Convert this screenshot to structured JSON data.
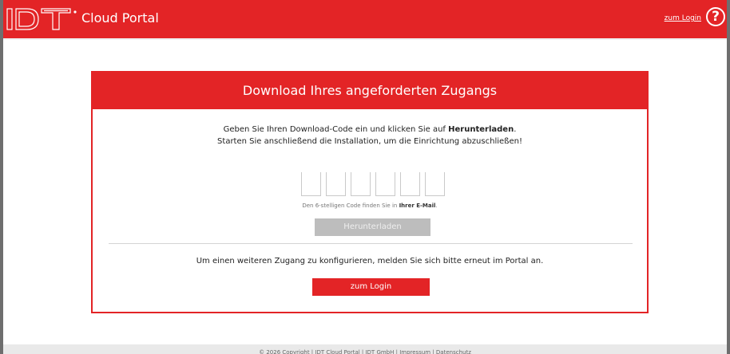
{
  "header": {
    "logo_text": "IDT",
    "brand": "Cloud Portal",
    "login_link": "zum Login",
    "help_symbol": "?",
    "color": "#e32426"
  },
  "panel": {
    "title": "Download Ihres angeforderten Zugangs",
    "intro_line1_pre": "Geben Sie Ihren Download-Code ein und klicken Sie auf ",
    "intro_line1_bold": "Herunterladen",
    "intro_line1_post": ".",
    "intro_line2": "Starten Sie anschließend die Installation, um die Einrichtung abzuschließen!",
    "code_digits": [
      "",
      "",
      "",
      "",
      "",
      ""
    ],
    "code_hint_pre": "Den 6-stelligen Code finden Sie in ",
    "code_hint_bold": "Ihrer E-Mail",
    "code_hint_post": ".",
    "download_button": "Herunterladen",
    "config_text": "Um einen weiteren Zugang zu konfigurieren, melden Sie sich bitte erneut im Portal an.",
    "login_button": "zum Login"
  },
  "footer": {
    "text": "© 2026 Copyright | IDT Cloud Portal | IDT GmbH | Impressum | Datenschutz"
  }
}
